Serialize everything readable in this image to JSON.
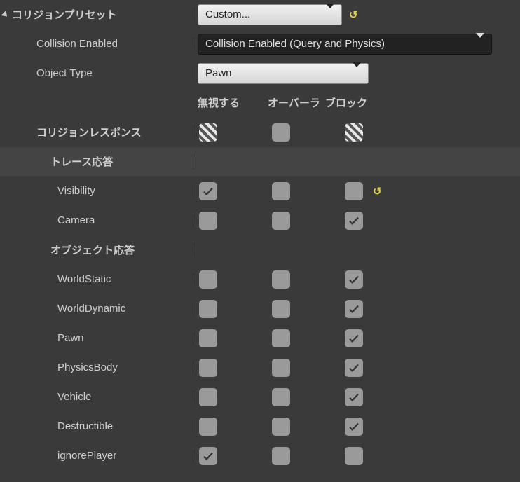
{
  "header": {
    "title": "コリジョンプリセット"
  },
  "preset": {
    "value": "Custom...",
    "hasReset": true
  },
  "collisionEnabled": {
    "label": "Collision Enabled",
    "value": "Collision Enabled (Query and Physics)"
  },
  "objectType": {
    "label": "Object Type",
    "value": "Pawn"
  },
  "columns": {
    "ignore": "無視する",
    "overlap": "オーバーラ",
    "block": "ブロック"
  },
  "collisionResponses": {
    "label": "コリジョンレスポンス",
    "ignore": "mixed",
    "overlap": "unchecked",
    "block": "mixed"
  },
  "traceSection": {
    "label": "トレース応答"
  },
  "traceRows": [
    {
      "name": "Visibility",
      "ignore": "checked",
      "overlap": "unchecked",
      "block": "unchecked",
      "hasReset": true
    },
    {
      "name": "Camera",
      "ignore": "unchecked",
      "overlap": "unchecked",
      "block": "checked"
    }
  ],
  "objectSection": {
    "label": "オブジェクト応答"
  },
  "objectRows": [
    {
      "name": "WorldStatic",
      "ignore": "unchecked",
      "overlap": "unchecked",
      "block": "checked"
    },
    {
      "name": "WorldDynamic",
      "ignore": "unchecked",
      "overlap": "unchecked",
      "block": "checked"
    },
    {
      "name": "Pawn",
      "ignore": "unchecked",
      "overlap": "unchecked",
      "block": "checked"
    },
    {
      "name": "PhysicsBody",
      "ignore": "unchecked",
      "overlap": "unchecked",
      "block": "checked"
    },
    {
      "name": "Vehicle",
      "ignore": "unchecked",
      "overlap": "unchecked",
      "block": "checked"
    },
    {
      "name": "Destructible",
      "ignore": "unchecked",
      "overlap": "unchecked",
      "block": "checked"
    },
    {
      "name": "ignorePlayer",
      "ignore": "checked",
      "overlap": "unchecked",
      "block": "unchecked"
    }
  ]
}
